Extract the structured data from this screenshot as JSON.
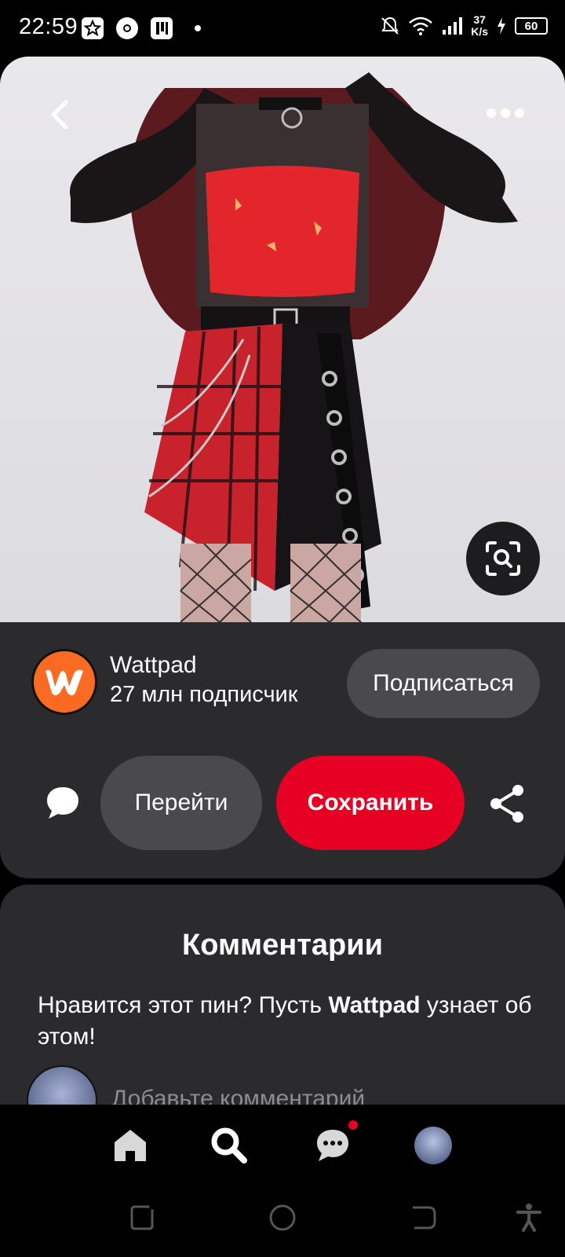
{
  "status_bar": {
    "time": "22:59",
    "speed_value": "37",
    "speed_unit": "K/s",
    "battery": "60",
    "icons": [
      "star-icon",
      "chrome-icon",
      "app-icon",
      "mute-icon",
      "wifi-icon",
      "signal-icon",
      "charging-icon"
    ]
  },
  "pin": {
    "icons": [
      "back-icon",
      "more-icon",
      "visual-search-icon"
    ]
  },
  "creator": {
    "name": "Wattpad",
    "followers": "27 млн подписчик",
    "subscribe_label": "Подписаться",
    "avatar_icon": "wattpad-logo-icon",
    "brand_color": "#f96b22"
  },
  "actions": {
    "goto_label": "Перейти",
    "save_label": "Сохранить",
    "save_color": "#e60023",
    "icons": [
      "comment-icon",
      "share-icon"
    ]
  },
  "comments": {
    "title": "Комментарии",
    "prompt_before": "Нравится этот пин? Пусть ",
    "prompt_name": "Wattpad",
    "prompt_after": " узнает об этом!",
    "placeholder": "Добавьте комментарий"
  },
  "bottom_nav": {
    "items": [
      "home-icon",
      "search-icon",
      "messages-icon",
      "profile-avatar"
    ]
  },
  "system_nav": {
    "items": [
      "recents-icon",
      "home-circle-icon",
      "back-system-icon",
      "accessibility-icon"
    ]
  }
}
